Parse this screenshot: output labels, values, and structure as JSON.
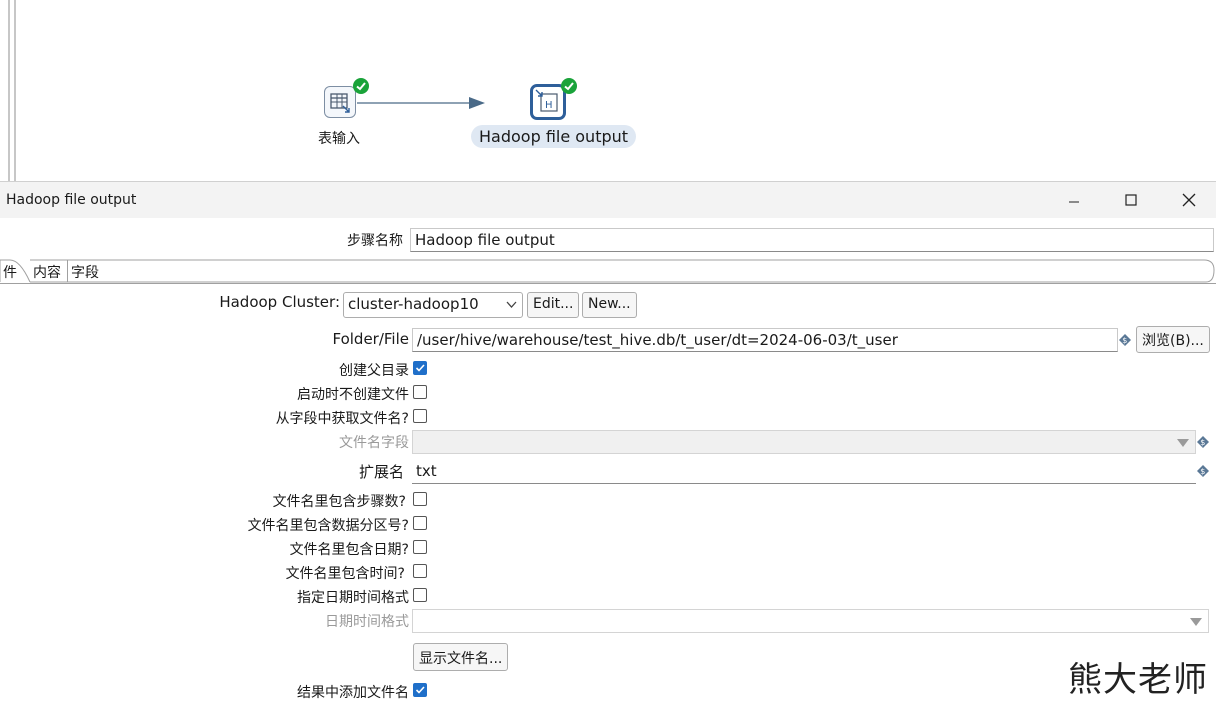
{
  "canvas": {
    "nodes": [
      {
        "label": "表输入",
        "icon": "table-input-icon",
        "status": "check-icon"
      },
      {
        "label": "Hadoop file output",
        "icon": "hadoop-output-icon",
        "status": "check-icon"
      }
    ]
  },
  "dialog": {
    "title": "Hadoop file output",
    "step_name_label": "步骤名称",
    "step_name_value": "Hadoop file output",
    "tabs": [
      "件",
      "内容",
      "字段"
    ],
    "hadoop_cluster": {
      "label": "Hadoop Cluster:",
      "value": "cluster-hadoop10",
      "edit_label": "Edit...",
      "new_label": "New..."
    },
    "folder_file": {
      "label": "Folder/File",
      "value": "/user/hive/warehouse/test_hive.db/t_user/dt=2024-06-03/t_user",
      "browse_label": "浏览(B)..."
    },
    "options": {
      "create_parent": {
        "label": "创建父目录",
        "checked": true
      },
      "no_create_on_start": {
        "label": "启动时不创建文件",
        "checked": false
      },
      "filename_from_field": {
        "label": "从字段中获取文件名?",
        "checked": false
      }
    },
    "filename_field_label": "文件名字段",
    "extension": {
      "label": "扩展名",
      "value": "txt"
    },
    "include_options": [
      {
        "label": "文件名里包含步骤数?",
        "checked": false
      },
      {
        "label": "文件名里包含数据分区号?",
        "checked": false
      },
      {
        "label": "文件名里包含日期?",
        "checked": false
      },
      {
        "label": "文件名里包含时间?",
        "checked": false
      },
      {
        "label": "指定日期时间格式",
        "checked": false
      }
    ],
    "datetime_format_label": "日期时间格式",
    "show_filename_label": "显示文件名...",
    "add_to_result": {
      "label": "结果中添加文件名",
      "checked": true
    }
  },
  "watermark": "熊大老师",
  "colors": {
    "accent": "#1f6fc9",
    "ok": "#1aa33a",
    "selected_border": "#2e5f9a"
  }
}
